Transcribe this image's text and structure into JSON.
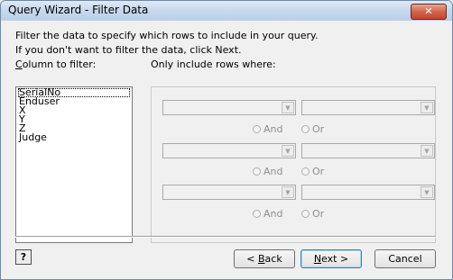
{
  "window": {
    "title": "Query Wizard - Filter Data",
    "close_label": "✕"
  },
  "description": {
    "line1": "Filter the data to specify which rows to include in your query.",
    "line2": "If you don't want to filter the data, click Next."
  },
  "column_label": {
    "mnemonic": "C",
    "rest": "olumn to filter:"
  },
  "rows_label": "Only include rows where:",
  "columns": [
    "SerialNo",
    "Enduser",
    "X",
    "Y",
    "Z",
    "Judge"
  ],
  "selected_column": "SerialNo",
  "conditions": [
    {
      "operator_value": "",
      "criteria_value": "",
      "and_label": "And",
      "or_label": "Or"
    },
    {
      "operator_value": "",
      "criteria_value": "",
      "and_label": "And",
      "or_label": "Or"
    },
    {
      "operator_value": "",
      "criteria_value": "",
      "and_label": "And",
      "or_label": "Or"
    }
  ],
  "buttons": {
    "help_label": "?",
    "back": {
      "prefix": "< ",
      "mnemonic": "B",
      "rest": "ack"
    },
    "next": {
      "mnemonic": "N",
      "rest": "ext >"
    },
    "cancel": "Cancel"
  },
  "icons": {
    "help": "help-icon",
    "dropdown": "chevron-down-icon",
    "close": "close-icon"
  }
}
